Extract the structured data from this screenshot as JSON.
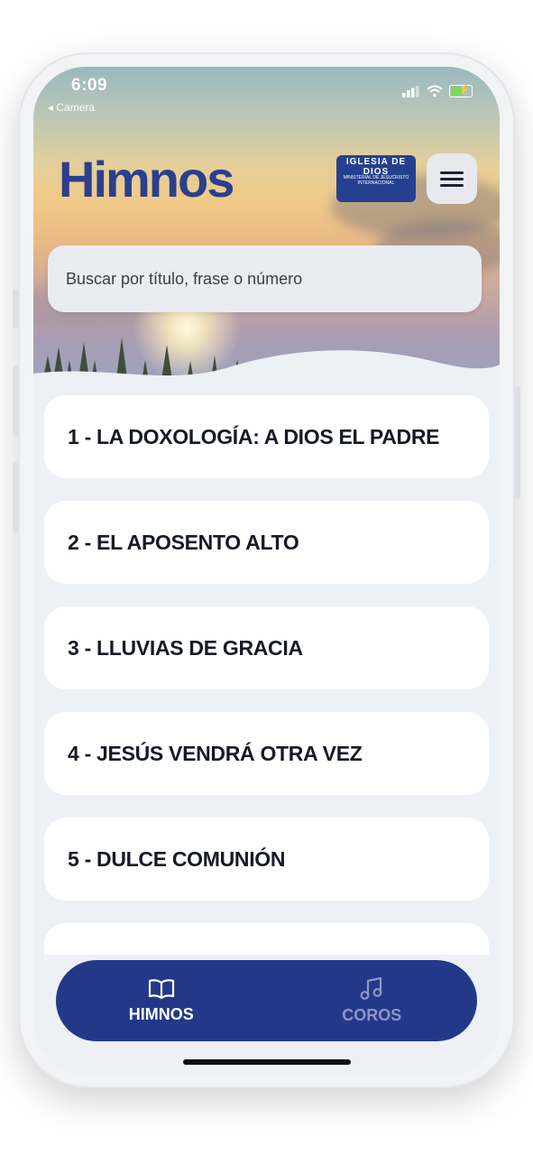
{
  "status_bar": {
    "time": "6:09",
    "back_app": "◂ Camera"
  },
  "header": {
    "title": "Himnos",
    "logo": {
      "arc_text": "IGLESIA DE DIOS",
      "sub_text": "MINISTERIAL DE JESUCRISTO INTERNACIONAL"
    }
  },
  "search": {
    "placeholder": "Buscar por título, frase o número",
    "value": ""
  },
  "hymns": [
    {
      "label": "1 - LA DOXOLOGÍA: A DIOS EL PADRE"
    },
    {
      "label": "2 - EL APOSENTO ALTO"
    },
    {
      "label": "3 - LLUVIAS DE GRACIA"
    },
    {
      "label": "4 - JESÚS VENDRÁ OTRA VEZ"
    },
    {
      "label": "5 - DULCE COMUNIÓN"
    },
    {
      "label": ""
    }
  ],
  "bottom_nav": {
    "items": [
      {
        "label": "HIMNOS",
        "icon": "book-icon",
        "active": true
      },
      {
        "label": "COROS",
        "icon": "music-note-icon",
        "active": false
      }
    ]
  },
  "colors": {
    "brand": "#2b3f8c",
    "nav_bg": "#24388a",
    "nav_inactive": "#8d97c4"
  }
}
